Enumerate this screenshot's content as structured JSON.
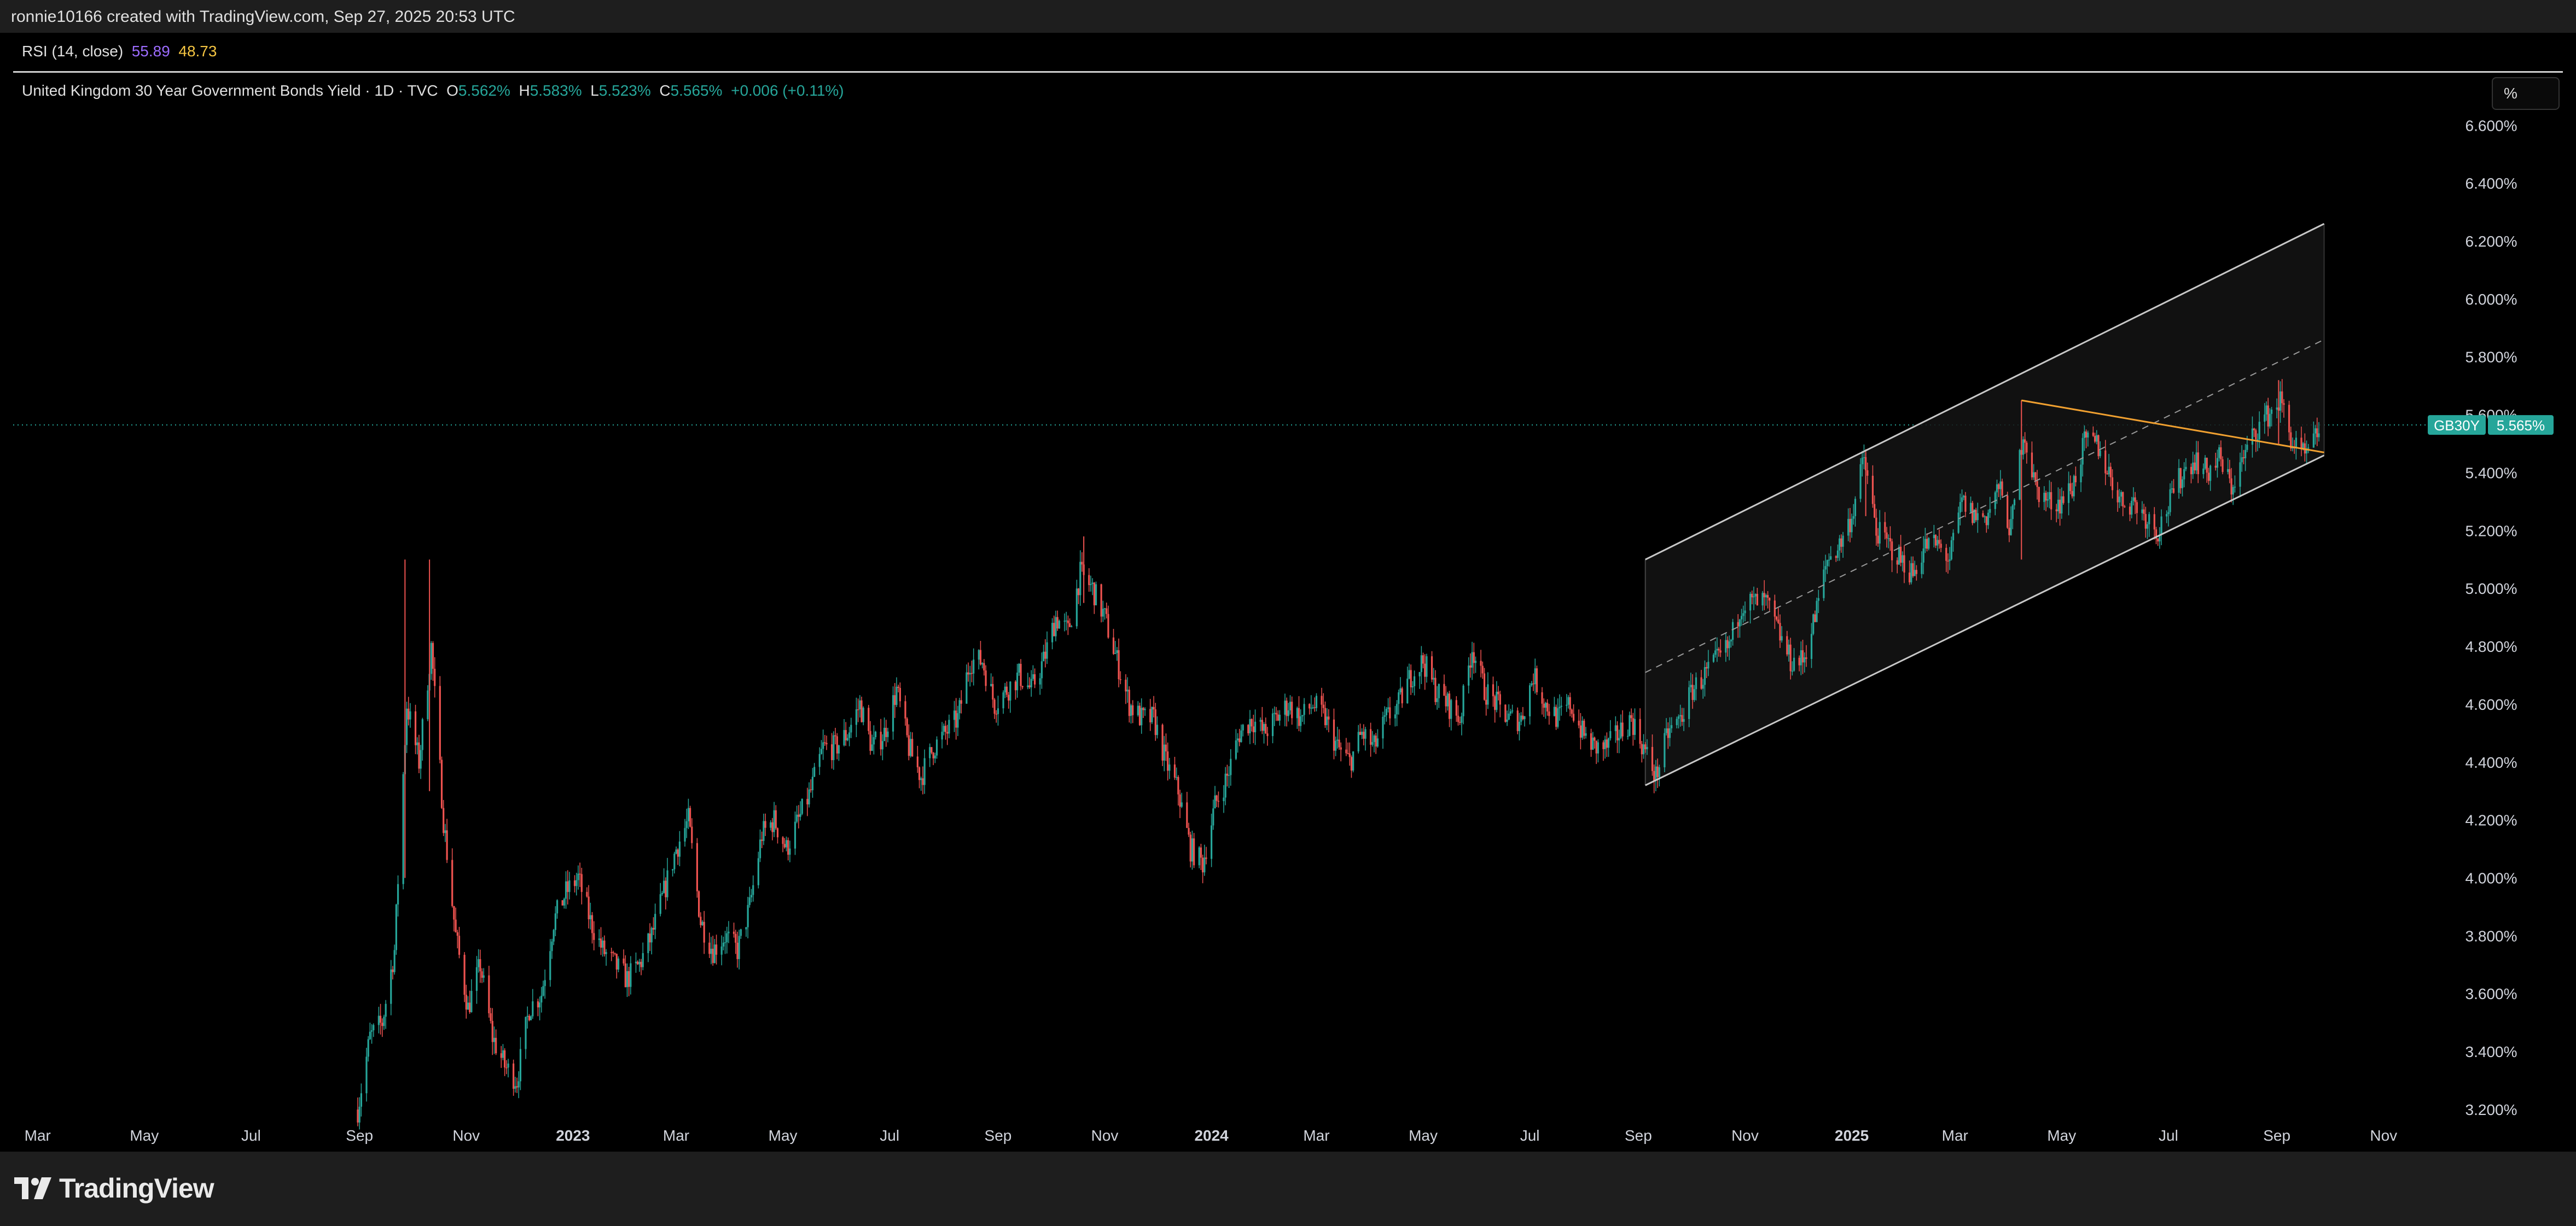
{
  "header": {
    "attribution": "ronnie10166 created with TradingView.com, Sep 27, 2025 20:53 UTC"
  },
  "rsi": {
    "label": "RSI (14, close)",
    "value1": "55.89",
    "value2": "48.73",
    "color1": "#9c6cff",
    "color2": "#f5c542"
  },
  "legend": {
    "title": "United Kingdom 30 Year Government Bonds Yield · 1D · TVC",
    "o_label": "O",
    "o": "5.562%",
    "h_label": "H",
    "h": "5.583%",
    "l_label": "L",
    "l": "5.523%",
    "c_label": "C",
    "c": "5.565%",
    "change": "+0.006 (+0.11%)"
  },
  "unit_button": {
    "label": "%"
  },
  "price_tag": {
    "symbol": "GB30Y",
    "value": "5.565%"
  },
  "footer": {
    "brand": "TradingView"
  },
  "colors": {
    "up": "#26a69a",
    "down": "#ef5350",
    "channel": "#c8c8c8",
    "trendline": "#f0a030",
    "background": "#000000"
  },
  "chart_data": {
    "type": "candlestick",
    "y_unit": "%",
    "ylim": [
      3.13,
      6.78
    ],
    "y_ticks": [
      "6.600%",
      "6.400%",
      "6.200%",
      "6.000%",
      "5.800%",
      "5.600%",
      "5.400%",
      "5.200%",
      "5.000%",
      "4.800%",
      "4.600%",
      "4.400%",
      "4.200%",
      "4.000%",
      "3.800%",
      "3.600%",
      "3.400%",
      "3.200%"
    ],
    "y_tick_values": [
      6.6,
      6.4,
      6.2,
      6.0,
      5.8,
      5.6,
      5.4,
      5.2,
      5.0,
      4.8,
      4.6,
      4.4,
      4.2,
      4.0,
      3.8,
      3.6,
      3.4,
      3.2
    ],
    "x_range": [
      "2022-02-15",
      "2025-11-25"
    ],
    "x_ticks": [
      {
        "label": "Mar",
        "date": "2022-03-01",
        "bold": false
      },
      {
        "label": "May",
        "date": "2022-05-01",
        "bold": false
      },
      {
        "label": "Jul",
        "date": "2022-07-01",
        "bold": false
      },
      {
        "label": "Sep",
        "date": "2022-09-01",
        "bold": false
      },
      {
        "label": "Nov",
        "date": "2022-11-01",
        "bold": false
      },
      {
        "label": "2023",
        "date": "2023-01-01",
        "bold": true
      },
      {
        "label": "Mar",
        "date": "2023-03-01",
        "bold": false
      },
      {
        "label": "May",
        "date": "2023-05-01",
        "bold": false
      },
      {
        "label": "Jul",
        "date": "2023-07-01",
        "bold": false
      },
      {
        "label": "Sep",
        "date": "2023-09-01",
        "bold": false
      },
      {
        "label": "Nov",
        "date": "2023-11-01",
        "bold": false
      },
      {
        "label": "2024",
        "date": "2024-01-01",
        "bold": true
      },
      {
        "label": "Mar",
        "date": "2024-03-01",
        "bold": false
      },
      {
        "label": "May",
        "date": "2024-05-01",
        "bold": false
      },
      {
        "label": "Jul",
        "date": "2024-07-01",
        "bold": false
      },
      {
        "label": "Sep",
        "date": "2024-09-01",
        "bold": false
      },
      {
        "label": "Nov",
        "date": "2024-11-01",
        "bold": false
      },
      {
        "label": "2025",
        "date": "2025-01-01",
        "bold": true
      },
      {
        "label": "Mar",
        "date": "2025-03-01",
        "bold": false
      },
      {
        "label": "May",
        "date": "2025-05-01",
        "bold": false
      },
      {
        "label": "Jul",
        "date": "2025-07-01",
        "bold": false
      },
      {
        "label": "Sep",
        "date": "2025-09-01",
        "bold": false
      },
      {
        "label": "Nov",
        "date": "2025-11-01",
        "bold": false
      }
    ],
    "current_price": 5.565,
    "close_path": [
      {
        "date": "2022-08-31",
        "value": 3.2
      },
      {
        "date": "2022-09-07",
        "value": 3.45
      },
      {
        "date": "2022-09-14",
        "value": 3.5
      },
      {
        "date": "2022-09-21",
        "value": 3.75
      },
      {
        "date": "2022-09-28",
        "value": 4.6
      },
      {
        "date": "2022-10-05",
        "value": 4.4
      },
      {
        "date": "2022-10-12",
        "value": 4.8
      },
      {
        "date": "2022-10-19",
        "value": 4.2
      },
      {
        "date": "2022-10-26",
        "value": 3.8
      },
      {
        "date": "2022-11-02",
        "value": 3.55
      },
      {
        "date": "2022-11-09",
        "value": 3.7
      },
      {
        "date": "2022-11-16",
        "value": 3.45
      },
      {
        "date": "2022-11-23",
        "value": 3.35
      },
      {
        "date": "2022-11-30",
        "value": 3.3
      },
      {
        "date": "2022-12-07",
        "value": 3.55
      },
      {
        "date": "2022-12-14",
        "value": 3.6
      },
      {
        "date": "2022-12-21",
        "value": 3.85
      },
      {
        "date": "2022-12-28",
        "value": 3.95
      },
      {
        "date": "2023-01-04",
        "value": 4.0
      },
      {
        "date": "2023-01-11",
        "value": 3.85
      },
      {
        "date": "2023-01-18",
        "value": 3.75
      },
      {
        "date": "2023-01-25",
        "value": 3.7
      },
      {
        "date": "2023-02-01",
        "value": 3.65
      },
      {
        "date": "2023-02-08",
        "value": 3.7
      },
      {
        "date": "2023-02-15",
        "value": 3.8
      },
      {
        "date": "2023-02-22",
        "value": 3.95
      },
      {
        "date": "2023-03-01",
        "value": 4.1
      },
      {
        "date": "2023-03-08",
        "value": 4.2
      },
      {
        "date": "2023-03-15",
        "value": 3.85
      },
      {
        "date": "2023-03-22",
        "value": 3.75
      },
      {
        "date": "2023-03-29",
        "value": 3.8
      },
      {
        "date": "2023-04-05",
        "value": 3.75
      },
      {
        "date": "2023-04-12",
        "value": 3.9
      },
      {
        "date": "2023-04-19",
        "value": 4.15
      },
      {
        "date": "2023-04-26",
        "value": 4.2
      },
      {
        "date": "2023-05-03",
        "value": 4.1
      },
      {
        "date": "2023-05-10",
        "value": 4.2
      },
      {
        "date": "2023-05-17",
        "value": 4.3
      },
      {
        "date": "2023-05-24",
        "value": 4.45
      },
      {
        "date": "2023-05-31",
        "value": 4.45
      },
      {
        "date": "2023-06-07",
        "value": 4.5
      },
      {
        "date": "2023-06-14",
        "value": 4.6
      },
      {
        "date": "2023-06-21",
        "value": 4.45
      },
      {
        "date": "2023-06-28",
        "value": 4.5
      },
      {
        "date": "2023-07-05",
        "value": 4.65
      },
      {
        "date": "2023-07-12",
        "value": 4.45
      },
      {
        "date": "2023-07-19",
        "value": 4.35
      },
      {
        "date": "2023-07-26",
        "value": 4.45
      },
      {
        "date": "2023-08-02",
        "value": 4.5
      },
      {
        "date": "2023-08-09",
        "value": 4.55
      },
      {
        "date": "2023-08-16",
        "value": 4.75
      },
      {
        "date": "2023-08-23",
        "value": 4.75
      },
      {
        "date": "2023-08-30",
        "value": 4.6
      },
      {
        "date": "2023-09-06",
        "value": 4.65
      },
      {
        "date": "2023-09-13",
        "value": 4.7
      },
      {
        "date": "2023-09-20",
        "value": 4.65
      },
      {
        "date": "2023-09-27",
        "value": 4.75
      },
      {
        "date": "2023-10-04",
        "value": 4.9
      },
      {
        "date": "2023-10-11",
        "value": 4.85
      },
      {
        "date": "2023-10-18",
        "value": 5.05
      },
      {
        "date": "2023-10-25",
        "value": 5.0
      },
      {
        "date": "2023-11-01",
        "value": 4.9
      },
      {
        "date": "2023-11-08",
        "value": 4.75
      },
      {
        "date": "2023-11-15",
        "value": 4.6
      },
      {
        "date": "2023-11-22",
        "value": 4.55
      },
      {
        "date": "2023-11-29",
        "value": 4.55
      },
      {
        "date": "2023-12-06",
        "value": 4.4
      },
      {
        "date": "2023-12-13",
        "value": 4.3
      },
      {
        "date": "2023-12-20",
        "value": 4.1
      },
      {
        "date": "2023-12-27",
        "value": 4.05
      },
      {
        "date": "2024-01-03",
        "value": 4.25
      },
      {
        "date": "2024-01-10",
        "value": 4.35
      },
      {
        "date": "2024-01-17",
        "value": 4.5
      },
      {
        "date": "2024-01-24",
        "value": 4.55
      },
      {
        "date": "2024-01-31",
        "value": 4.5
      },
      {
        "date": "2024-02-07",
        "value": 4.55
      },
      {
        "date": "2024-02-14",
        "value": 4.6
      },
      {
        "date": "2024-02-21",
        "value": 4.55
      },
      {
        "date": "2024-02-28",
        "value": 4.6
      },
      {
        "date": "2024-03-06",
        "value": 4.55
      },
      {
        "date": "2024-03-13",
        "value": 4.45
      },
      {
        "date": "2024-03-20",
        "value": 4.4
      },
      {
        "date": "2024-03-27",
        "value": 4.5
      },
      {
        "date": "2024-04-03",
        "value": 4.45
      },
      {
        "date": "2024-04-10",
        "value": 4.55
      },
      {
        "date": "2024-04-17",
        "value": 4.6
      },
      {
        "date": "2024-04-24",
        "value": 4.7
      },
      {
        "date": "2024-05-01",
        "value": 4.75
      },
      {
        "date": "2024-05-08",
        "value": 4.65
      },
      {
        "date": "2024-05-15",
        "value": 4.6
      },
      {
        "date": "2024-05-22",
        "value": 4.55
      },
      {
        "date": "2024-05-29",
        "value": 4.8
      },
      {
        "date": "2024-06-05",
        "value": 4.65
      },
      {
        "date": "2024-06-12",
        "value": 4.6
      },
      {
        "date": "2024-06-19",
        "value": 4.55
      },
      {
        "date": "2024-06-26",
        "value": 4.55
      },
      {
        "date": "2024-07-03",
        "value": 4.7
      },
      {
        "date": "2024-07-10",
        "value": 4.6
      },
      {
        "date": "2024-07-17",
        "value": 4.55
      },
      {
        "date": "2024-07-24",
        "value": 4.6
      },
      {
        "date": "2024-07-31",
        "value": 4.5
      },
      {
        "date": "2024-08-07",
        "value": 4.45
      },
      {
        "date": "2024-08-14",
        "value": 4.45
      },
      {
        "date": "2024-08-21",
        "value": 4.5
      },
      {
        "date": "2024-08-28",
        "value": 4.55
      },
      {
        "date": "2024-09-04",
        "value": 4.45
      },
      {
        "date": "2024-09-11",
        "value": 4.35
      },
      {
        "date": "2024-09-18",
        "value": 4.5
      },
      {
        "date": "2024-09-25",
        "value": 4.55
      },
      {
        "date": "2024-10-02",
        "value": 4.65
      },
      {
        "date": "2024-10-09",
        "value": 4.7
      },
      {
        "date": "2024-10-16",
        "value": 4.75
      },
      {
        "date": "2024-10-23",
        "value": 4.8
      },
      {
        "date": "2024-10-30",
        "value": 4.95
      },
      {
        "date": "2024-11-06",
        "value": 4.95
      },
      {
        "date": "2024-11-13",
        "value": 4.95
      },
      {
        "date": "2024-11-20",
        "value": 4.85
      },
      {
        "date": "2024-11-27",
        "value": 4.75
      },
      {
        "date": "2024-12-04",
        "value": 4.75
      },
      {
        "date": "2024-12-11",
        "value": 4.9
      },
      {
        "date": "2024-12-18",
        "value": 5.1
      },
      {
        "date": "2024-12-25",
        "value": 5.15
      },
      {
        "date": "2025-01-01",
        "value": 5.25
      },
      {
        "date": "2025-01-08",
        "value": 5.45
      },
      {
        "date": "2025-01-15",
        "value": 5.2
      },
      {
        "date": "2025-01-22",
        "value": 5.15
      },
      {
        "date": "2025-01-29",
        "value": 5.1
      },
      {
        "date": "2025-02-05",
        "value": 5.05
      },
      {
        "date": "2025-02-12",
        "value": 5.15
      },
      {
        "date": "2025-02-19",
        "value": 5.15
      },
      {
        "date": "2025-02-26",
        "value": 5.1
      },
      {
        "date": "2025-03-05",
        "value": 5.3
      },
      {
        "date": "2025-03-12",
        "value": 5.25
      },
      {
        "date": "2025-03-19",
        "value": 5.25
      },
      {
        "date": "2025-03-26",
        "value": 5.35
      },
      {
        "date": "2025-04-02",
        "value": 5.2
      },
      {
        "date": "2025-04-09",
        "value": 5.55
      },
      {
        "date": "2025-04-16",
        "value": 5.35
      },
      {
        "date": "2025-04-23",
        "value": 5.3
      },
      {
        "date": "2025-04-30",
        "value": 5.3
      },
      {
        "date": "2025-05-07",
        "value": 5.35
      },
      {
        "date": "2025-05-14",
        "value": 5.5
      },
      {
        "date": "2025-05-21",
        "value": 5.5
      },
      {
        "date": "2025-05-28",
        "value": 5.4
      },
      {
        "date": "2025-06-04",
        "value": 5.3
      },
      {
        "date": "2025-06-11",
        "value": 5.3
      },
      {
        "date": "2025-06-18",
        "value": 5.25
      },
      {
        "date": "2025-06-25",
        "value": 5.2
      },
      {
        "date": "2025-07-02",
        "value": 5.3
      },
      {
        "date": "2025-07-09",
        "value": 5.4
      },
      {
        "date": "2025-07-16",
        "value": 5.45
      },
      {
        "date": "2025-07-23",
        "value": 5.4
      },
      {
        "date": "2025-07-30",
        "value": 5.45
      },
      {
        "date": "2025-08-06",
        "value": 5.35
      },
      {
        "date": "2025-08-13",
        "value": 5.45
      },
      {
        "date": "2025-08-20",
        "value": 5.55
      },
      {
        "date": "2025-08-27",
        "value": 5.6
      },
      {
        "date": "2025-09-03",
        "value": 5.65
      },
      {
        "date": "2025-09-10",
        "value": 5.5
      },
      {
        "date": "2025-09-17",
        "value": 5.45
      },
      {
        "date": "2025-09-22",
        "value": 5.5
      },
      {
        "date": "2025-09-26",
        "value": 5.565
      }
    ],
    "spikes": [
      {
        "date": "2022-09-27",
        "high": 5.1,
        "low": 4.0
      },
      {
        "date": "2022-10-11",
        "high": 5.1,
        "low": 4.3
      },
      {
        "date": "2023-10-20",
        "high": 5.18,
        "low": 4.95
      },
      {
        "date": "2025-01-09",
        "high": 5.47,
        "low": 5.25
      },
      {
        "date": "2025-04-08",
        "high": 5.65,
        "low": 5.1
      },
      {
        "date": "2025-09-02",
        "high": 5.72,
        "low": 5.5
      }
    ],
    "drawings": {
      "channel_lower": [
        {
          "date": "2024-09-05",
          "value": 4.32
        },
        {
          "date": "2025-09-28",
          "value": 5.46
        }
      ],
      "channel_upper": [
        {
          "date": "2024-09-05",
          "value": 5.1
        },
        {
          "date": "2025-09-28",
          "value": 6.26
        }
      ],
      "channel_mid": [
        {
          "date": "2024-09-05",
          "value": 4.71
        },
        {
          "date": "2025-09-28",
          "value": 5.86
        }
      ],
      "trendline": [
        {
          "date": "2025-04-08",
          "value": 5.65
        },
        {
          "date": "2025-09-28",
          "value": 5.47
        }
      ]
    }
  }
}
